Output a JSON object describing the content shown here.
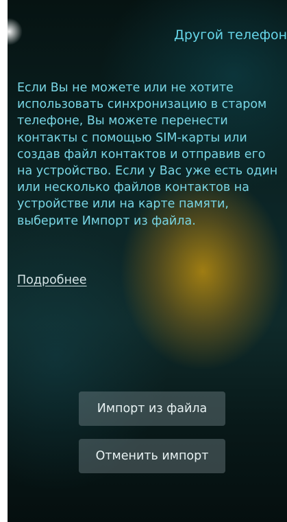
{
  "header": {
    "title": "Другой телефон"
  },
  "main": {
    "description": "Если Вы не можете или не хотите использовать синхронизацию в старом телефоне, Вы можете перенести контакты с помощью SIM-карты или создав файл контактов и отправив его на устройство. Если у Вас уже есть один или несколько файлов контактов на устройстве или на карте памяти, выберите Импорт из файла.",
    "more_link": "Подробнее"
  },
  "actions": {
    "import_from_file": "Импорт из файла",
    "cancel_import": "Отменить импорт"
  }
}
